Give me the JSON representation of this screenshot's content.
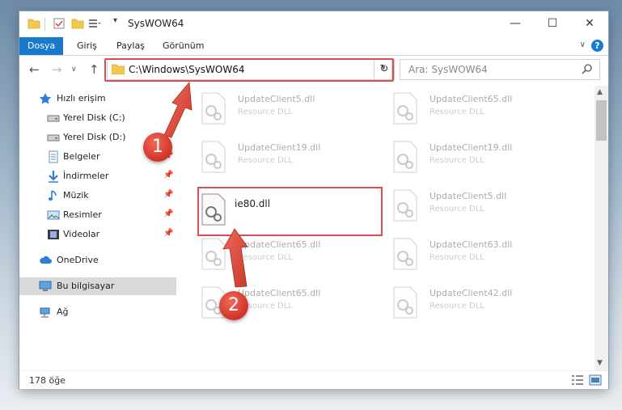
{
  "window": {
    "title": "SysWOW64"
  },
  "ribbon": {
    "tabs": [
      "Dosya",
      "Giriş",
      "Paylaş",
      "Görünüm"
    ],
    "help": "?"
  },
  "nav": {
    "address": "C:\\Windows\\SysWOW64",
    "search_placeholder": "Ara: SysWOW64"
  },
  "sidebar": {
    "items": [
      {
        "label": "Hızlı erişim",
        "icon": "star-icon"
      },
      {
        "label": "Yerel Disk (C:)",
        "icon": "drive-icon"
      },
      {
        "label": "Yerel Disk (D:)",
        "icon": "drive-icon"
      },
      {
        "label": "Belgeler",
        "icon": "documents-icon",
        "pinned": true
      },
      {
        "label": "İndirmeler",
        "icon": "download-icon",
        "pinned": true
      },
      {
        "label": "Müzik",
        "icon": "music-icon",
        "pinned": true
      },
      {
        "label": "Resimler",
        "icon": "pictures-icon",
        "pinned": true
      },
      {
        "label": "Videolar",
        "icon": "video-icon",
        "pinned": true
      },
      {
        "label": "OneDrive",
        "icon": "cloud-icon"
      },
      {
        "label": "Bu bilgisayar",
        "icon": "computer-icon",
        "selected": true
      },
      {
        "label": "Ağ",
        "icon": "network-icon"
      }
    ]
  },
  "files": [
    {
      "name": "UpdateClient5.dll",
      "type": "Resource DLL"
    },
    {
      "name": "UpdateClient65.dll",
      "type": "Resource DLL"
    },
    {
      "name": "UpdateClient19.dll",
      "type": "Resource DLL"
    },
    {
      "name": "UpdateClient19.dll",
      "type": "Resource DLL"
    },
    {
      "name": "ie80.dll",
      "type": ""
    },
    {
      "name": "UpdateClient5.dll",
      "type": "Resource DLL"
    },
    {
      "name": "UpdateClient65.dll",
      "type": "Resource DLL"
    },
    {
      "name": "UpdateClient63.dll",
      "type": "Resource DLL"
    },
    {
      "name": "UpdateClient65.dll",
      "type": "Resource DLL"
    },
    {
      "name": "UpdateClient42.dll",
      "type": "Resource DLL"
    }
  ],
  "status": {
    "item_count": "178 öğe"
  },
  "annotations": {
    "badge1": "1",
    "badge2": "2"
  },
  "colors": {
    "accent": "#1979ca",
    "highlight": "#d94f4f"
  }
}
